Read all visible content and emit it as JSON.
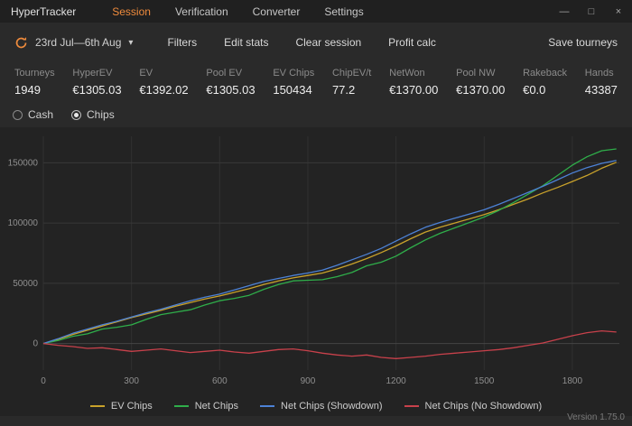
{
  "titlebar": {
    "app_title": "HyperTracker",
    "menu": [
      {
        "label": "Session",
        "active": true
      },
      {
        "label": "Verification",
        "active": false
      },
      {
        "label": "Converter",
        "active": false
      },
      {
        "label": "Settings",
        "active": false
      }
    ],
    "window": {
      "minimize": "—",
      "maximize": "□",
      "close": "×"
    }
  },
  "toolbar": {
    "date_range": "23rd Jul—6th Aug",
    "caret": "▾",
    "buttons": [
      "Filters",
      "Edit stats",
      "Clear session",
      "Profit calc"
    ],
    "save_label": "Save tourneys"
  },
  "stats": [
    {
      "label": "Tourneys",
      "value": "1949"
    },
    {
      "label": "HyperEV",
      "value": "€1305.03"
    },
    {
      "label": "EV",
      "value": "€1392.02"
    },
    {
      "label": "Pool EV",
      "value": "€1305.03"
    },
    {
      "label": "EV Chips",
      "value": "150434"
    },
    {
      "label": "ChipEV/t",
      "value": "77.2"
    },
    {
      "label": "NetWon",
      "value": "€1370.00"
    },
    {
      "label": "Pool NW",
      "value": "€1370.00"
    },
    {
      "label": "Rakeback",
      "value": "€0.0"
    },
    {
      "label": "Hands",
      "value": "43387"
    }
  ],
  "view_toggle": {
    "options": [
      {
        "label": "Cash",
        "selected": false
      },
      {
        "label": "Chips",
        "selected": true
      }
    ]
  },
  "chart_data": {
    "type": "line",
    "title": "",
    "xlabel": "",
    "ylabel": "",
    "xlim": [
      0,
      1960
    ],
    "ylim": [
      -22000,
      172000
    ],
    "xticks": [
      0,
      300,
      600,
      900,
      1200,
      1500,
      1800
    ],
    "yticks": [
      0,
      50000,
      100000,
      150000
    ],
    "grid": true,
    "legend_position": "bottom",
    "x": [
      0,
      50,
      100,
      150,
      200,
      250,
      300,
      350,
      400,
      450,
      500,
      550,
      600,
      650,
      700,
      750,
      800,
      850,
      900,
      950,
      1000,
      1050,
      1100,
      1150,
      1200,
      1250,
      1300,
      1350,
      1400,
      1450,
      1500,
      1550,
      1600,
      1650,
      1700,
      1750,
      1800,
      1850,
      1900,
      1950
    ],
    "series": [
      {
        "name": "EV Chips",
        "color": "#c9a22b",
        "values": [
          0,
          3500,
          7500,
          11000,
          14500,
          18000,
          21500,
          24500,
          27500,
          31000,
          34000,
          37000,
          39500,
          42500,
          45500,
          49000,
          52000,
          54500,
          56500,
          58500,
          62000,
          66000,
          70500,
          75500,
          81000,
          87000,
          92500,
          96500,
          100000,
          103500,
          107000,
          111000,
          115500,
          120000,
          125000,
          129500,
          134500,
          139500,
          145500,
          150434
        ]
      },
      {
        "name": "Net Chips",
        "color": "#2fae4a",
        "values": [
          0,
          2500,
          6000,
          8000,
          12000,
          13500,
          15500,
          20000,
          24000,
          26000,
          28000,
          32000,
          35500,
          37500,
          40000,
          45000,
          49000,
          52000,
          52500,
          53000,
          55500,
          59000,
          64500,
          67500,
          72500,
          79500,
          86000,
          91500,
          96000,
          100500,
          105000,
          110500,
          117000,
          124000,
          131000,
          139500,
          148000,
          155000,
          160000,
          161500
        ]
      },
      {
        "name": "Net Chips (Showdown)",
        "color": "#4d82d6",
        "values": [
          0,
          4000,
          8500,
          12000,
          15500,
          18500,
          22000,
          25500,
          28500,
          32000,
          35500,
          38500,
          41000,
          44500,
          48000,
          51500,
          54000,
          56500,
          58500,
          61000,
          65000,
          69500,
          74000,
          79000,
          85000,
          91000,
          96500,
          100500,
          104000,
          107500,
          111000,
          115500,
          120500,
          125500,
          130500,
          136000,
          141500,
          146000,
          149500,
          152000
        ]
      },
      {
        "name": "Net Chips (No Showdown)",
        "color": "#c8414b",
        "values": [
          0,
          -1500,
          -2500,
          -4000,
          -3500,
          -5000,
          -6500,
          -5500,
          -4500,
          -6000,
          -7500,
          -6500,
          -5500,
          -7000,
          -8000,
          -6500,
          -5000,
          -4500,
          -6000,
          -8000,
          -9500,
          -10500,
          -9500,
          -11500,
          -12500,
          -11500,
          -10500,
          -9000,
          -8000,
          -7000,
          -6000,
          -5000,
          -3500,
          -1500,
          500,
          3500,
          6500,
          9000,
          10500,
          9500
        ]
      }
    ]
  },
  "footer": {
    "version": "Version 1.75.0"
  }
}
